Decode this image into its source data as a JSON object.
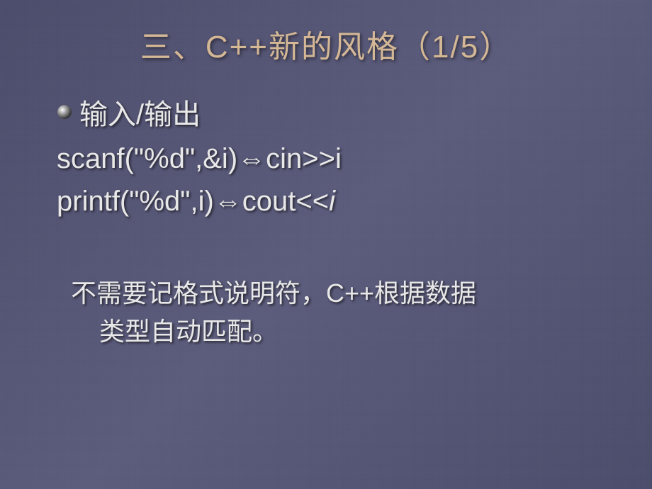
{
  "title": "三、C++新的风格（1/5）",
  "bullet": {
    "label": "输入/输出"
  },
  "code": {
    "line1_left": "scanf(\"%d\",&i)",
    "line1_right": "cin>>i",
    "line2_left": "printf(\"%d\",i)",
    "line2_right_prefix": "cout<<",
    "line2_right_var": "i",
    "arrow": "⇔"
  },
  "body": {
    "line1": "不需要记格式说明符，C++根据数据",
    "line2": "类型自动匹配。"
  }
}
